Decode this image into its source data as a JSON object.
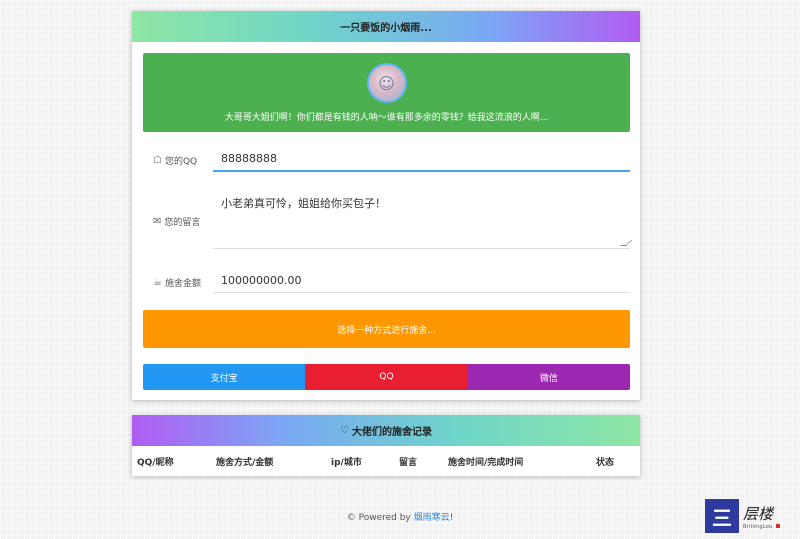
{
  "main_card": {
    "title": "一只要饭的小烟雨...",
    "banner_text": "大哥哥大姐们啊！你们都是有钱的人呐～谁有那多余的零钱？给我这流浪的人啊...",
    "qq_label": "您的QQ",
    "qq_value": "88888888",
    "message_label": "您的留言",
    "message_value": "小老弟真可怜，姐姐给你买包子！",
    "amount_label": "施舍金额",
    "amount_value": "100000000.00",
    "pick_method": "选择一种方式进行施舍...",
    "pay_methods": [
      "支付宝",
      "QQ",
      "微信"
    ]
  },
  "records_card": {
    "heart_glyph": "♡",
    "title": "大佬们的施舍记录",
    "columns": [
      "QQ/昵称",
      "施舍方式/金额",
      "ip/城市",
      "留言",
      "施舍时间/完成时间",
      "状态"
    ]
  },
  "footer": {
    "prefix": "© Powered by ",
    "link_text": "烟雨寒云",
    "suffix": "!"
  },
  "logo": {
    "box_glyph": "三",
    "chinese": "层楼",
    "english": "BrilimgLou"
  },
  "colors": {
    "banner": "#4caf50",
    "pick_bar": "#ff9800",
    "alipay": "#2196f3",
    "qq": "#e91e30",
    "wechat": "#9c27b0",
    "qq_underline": "#42a5f5"
  },
  "icons": {
    "qq_label_icon": "ghost-icon",
    "message_label_icon": "envelope-icon",
    "amount_label_icon": "cup-icon",
    "records_icon": "heart-icon"
  }
}
